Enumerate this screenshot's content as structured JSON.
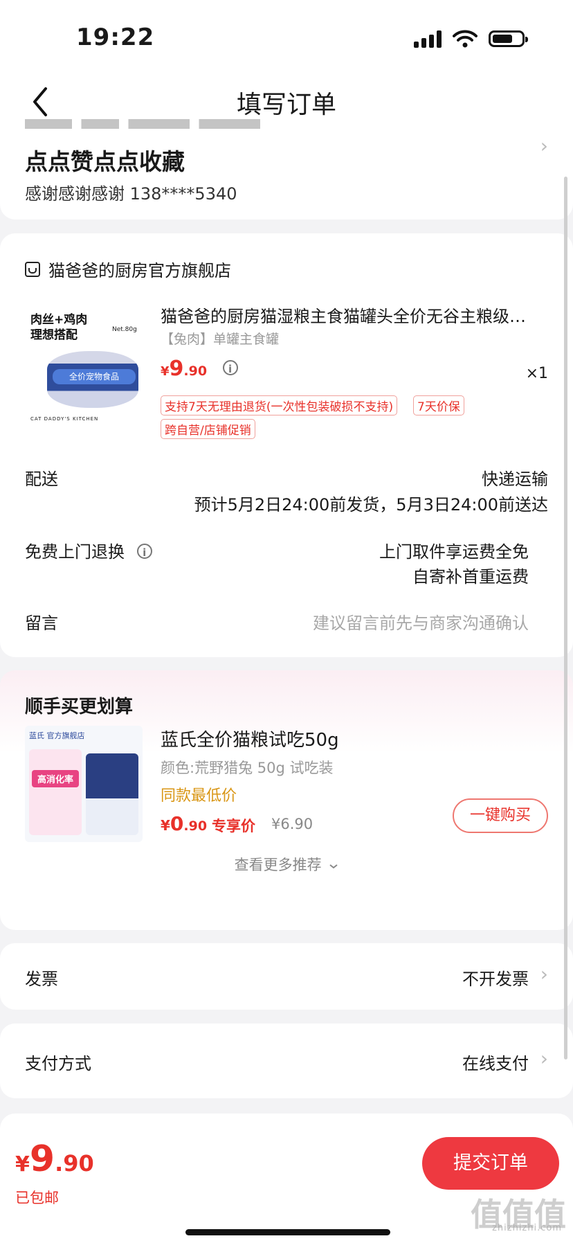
{
  "status_bar": {
    "time": "19:22"
  },
  "nav": {
    "title": "填写订单"
  },
  "address": {
    "name": "点点赞点点收藏",
    "contact": "感谢感谢感谢  138****5340"
  },
  "shop": {
    "name": "猫爸爸的厨房官方旗舰店"
  },
  "product": {
    "image_text": "肉丝+鸡肉\n理想搭配",
    "image_brand": "CAT DADDY'S KITCHEN",
    "image_band": "全价宠物食品",
    "image_net": "Net.80g",
    "title": "猫爸爸的厨房猫湿粮主食猫罐头全价无谷主粮级…",
    "spec": "【兔肉】单罐主食罐",
    "price_symbol": "¥",
    "price_int": "9",
    "price_dec": ".90",
    "quantity": "×1",
    "tags": [
      "支持7天无理由退货(一次性包装破损不支持)",
      "7天价保",
      "跨自营/店铺促销"
    ]
  },
  "delivery": {
    "label": "配送",
    "method": "快递运输",
    "estimate": "预计5月2日24:00前发货，5月3日24:00前送达"
  },
  "return": {
    "label": "免费上门退换",
    "line1": "上门取件享运费全免",
    "line2": "自寄补首重运费"
  },
  "message": {
    "label": "留言",
    "placeholder": "建议留言前先与商家沟通确认"
  },
  "recommend": {
    "title": "顺手买更划算",
    "image_head": "蓝氏 官方旗舰店",
    "image_badge": "高消化率",
    "name": "蓝氏全价猫粮试吃50g",
    "spec": "颜色:荒野猎兔 50g 试吃装",
    "low_price": "同款最低价",
    "price_symbol": "¥",
    "price_int": "0",
    "price_dec": ".90",
    "exclusive": "专享价",
    "original": "¥6.90",
    "buy_label": "一键购买",
    "more_label": "查看更多推荐"
  },
  "invoice": {
    "label": "发票",
    "value": "不开发票"
  },
  "payment": {
    "label": "支付方式",
    "value": "在线支付"
  },
  "footer": {
    "price_symbol": "¥",
    "price_int": "9",
    "price_dec": ".90",
    "shipping": "已包邮",
    "submit_label": "提交订单"
  },
  "watermark": {
    "text": "值值值",
    "sub": "zhizhizhi.com"
  },
  "colors": {
    "accent": "#e8312a",
    "submit_bg": "#ee3940",
    "low_price": "#d99614",
    "page_bg": "#f3f3f5"
  }
}
